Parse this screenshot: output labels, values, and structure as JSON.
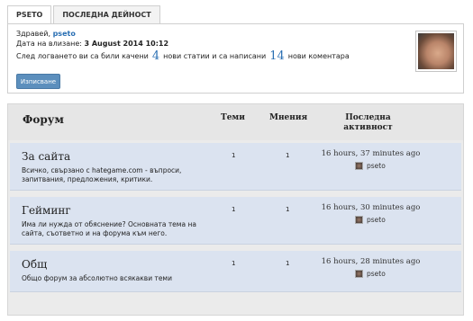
{
  "tabs": [
    {
      "label": "PSETO",
      "active": true
    },
    {
      "label": "ПОСЛЕДНА ДЕЙНОСТ",
      "active": false
    }
  ],
  "user_panel": {
    "greeting_prefix": "Здравей,",
    "username": "pseto",
    "join_label": "Дата на влизане:",
    "join_date": "3 August 2014 10:12",
    "stats_prefix": "След логването ви са били качени",
    "new_articles_count": "4",
    "stats_middle": "нови статии и са написани",
    "new_comments_count": "14",
    "stats_suffix": "нови коментара",
    "logout_label": "Изписване",
    "avatar_icon": "user-avatar-photo"
  },
  "forum": {
    "header": {
      "forum": "Форум",
      "topics": "Теми",
      "posts": "Мнения",
      "last_activity": "Последна активност"
    },
    "rows": [
      {
        "title": "За сайта",
        "description": "Всичко, свързано с hategame.com - въпроси, запитвания, предложения, критики.",
        "topics": "1",
        "posts": "1",
        "last_time": "16 hours, 37 minutes ago",
        "last_user": "pseto"
      },
      {
        "title": "Гейминг",
        "description": "Има ли нужда от обяснение? Основната тема на сайта, съответно и на форума към него.",
        "topics": "1",
        "posts": "1",
        "last_time": "16 hours, 30 minutes ago",
        "last_user": "pseto"
      },
      {
        "title": "Общ",
        "description": "Общо форум за абсолютно всякакви теми",
        "topics": "1",
        "posts": "1",
        "last_time": "16 hours, 28 minutes ago",
        "last_user": "pseto"
      }
    ]
  },
  "colors": {
    "accent": "#2a6fb3",
    "button": "#5c8fbd",
    "row_bg": "#dbe3f0",
    "header_bg": "#e6e6e6"
  }
}
